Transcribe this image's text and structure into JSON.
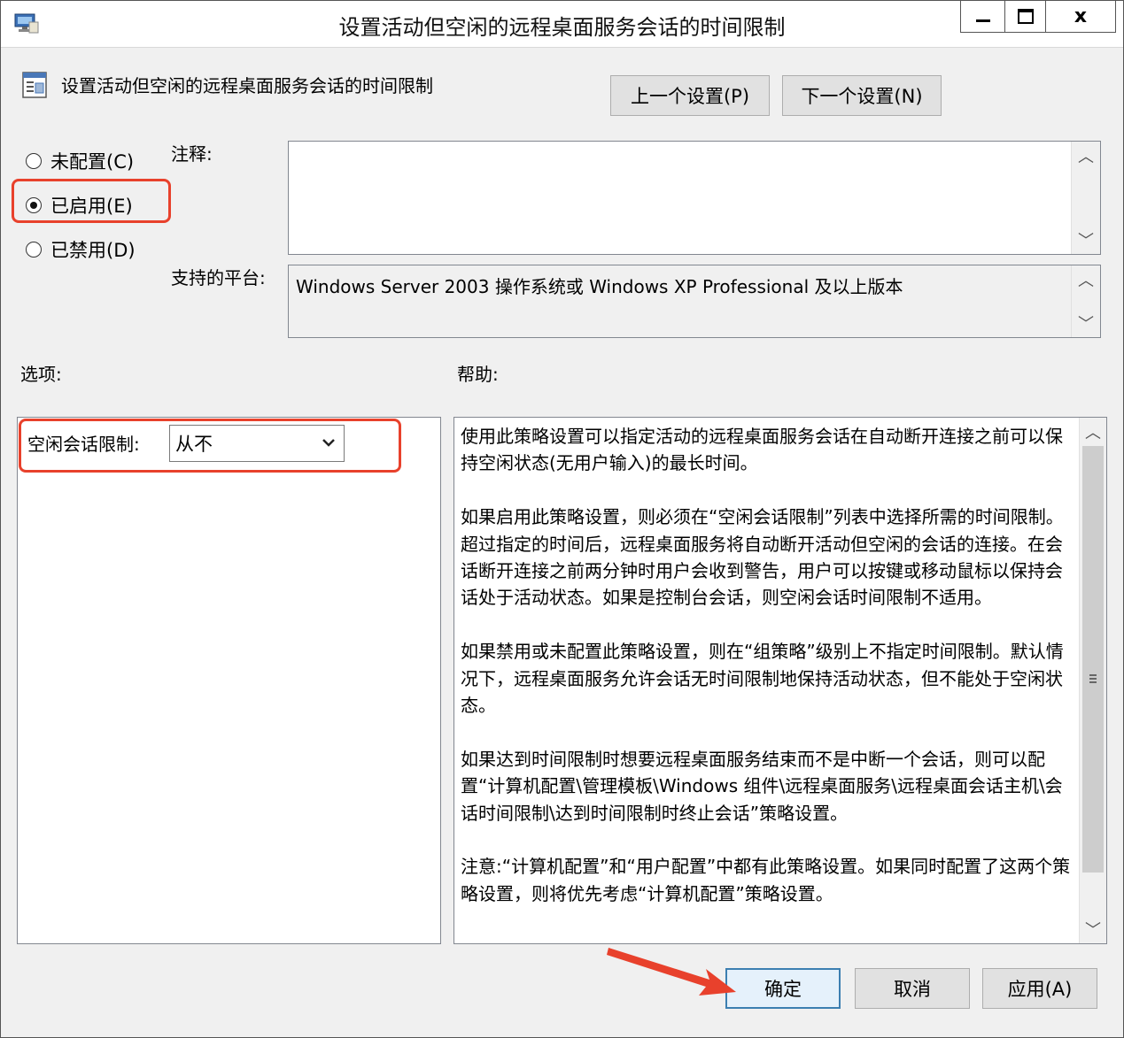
{
  "window": {
    "title": "设置活动但空闲的远程桌面服务会话的时间限制",
    "close_glyph": "x"
  },
  "header": {
    "policy_name": "设置活动但空闲的远程桌面服务会话的时间限制",
    "prev_button": "上一个设置(P)",
    "next_button": "下一个设置(N)"
  },
  "state": {
    "options": [
      {
        "label": "未配置(C)",
        "checked": false
      },
      {
        "label": "已启用(E)",
        "checked": true
      },
      {
        "label": "已禁用(D)",
        "checked": false
      }
    ]
  },
  "comment": {
    "label": "注释:",
    "value": ""
  },
  "platform": {
    "label": "支持的平台:",
    "value": "Windows Server 2003 操作系统或 Windows XP Professional 及以上版本"
  },
  "options_section": {
    "label": "选项:",
    "idle_limit_label": "空闲会话限制:",
    "idle_limit_value": "从不"
  },
  "help_section": {
    "label": "帮助:",
    "paragraphs": [
      "使用此策略设置可以指定活动的远程桌面服务会话在自动断开连接之前可以保持空闲状态(无用户输入)的最长时间。",
      "如果启用此策略设置，则必须在“空闲会话限制”列表中选择所需的时间限制。超过指定的时间后，远程桌面服务将自动断开活动但空闲的会话的连接。在会话断开连接之前两分钟时用户会收到警告，用户可以按键或移动鼠标以保持会话处于活动状态。如果是控制台会话，则空闲会话时间限制不适用。",
      "如果禁用或未配置此策略设置，则在“组策略”级别上不指定时间限制。默认情况下，远程桌面服务允许会话无时间限制地保持活动状态，但不能处于空闲状态。",
      "如果达到时间限制时想要远程桌面服务结束而不是中断一个会话，则可以配置“计算机配置\\管理模板\\Windows 组件\\远程桌面服务\\远程桌面会话主机\\会话时间限制\\达到时间限制时终止会话”策略设置。",
      "注意:“计算机配置”和“用户配置”中都有此策略设置。如果同时配置了这两个策略设置，则将优先考虑“计算机配置”策略设置。"
    ]
  },
  "footer": {
    "ok": "确定",
    "cancel": "取消",
    "apply": "应用(A)"
  },
  "colors": {
    "annotation_red": "#e8412c",
    "window_bg": "#f0f0f0"
  }
}
